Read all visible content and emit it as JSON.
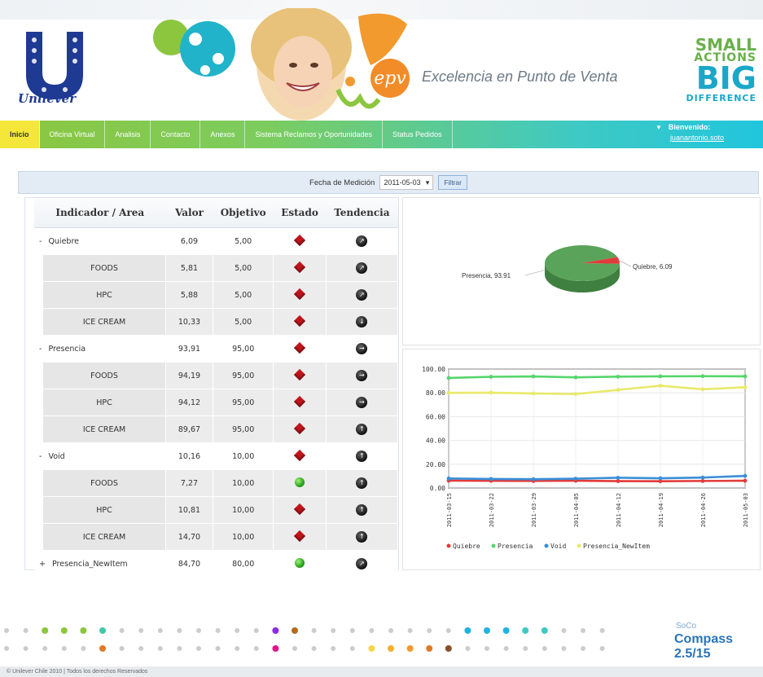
{
  "header": {
    "brand": "Unilever",
    "epv_logo": "epv",
    "tagline": "Excelencia en Punto de Venta",
    "slogan": {
      "line1": "SMALL",
      "line2": "ACTIONS",
      "line3": "BIG",
      "line4": "DIFFERENCE"
    }
  },
  "nav": {
    "items": [
      "Inicio",
      "Oficina Virtual",
      "Analisis",
      "Contacto",
      "Anexos",
      "Sistema Reclamos y Oportunidades",
      "Status Pedidos"
    ],
    "active": "Inicio",
    "welcome_label": "Bienvenido:",
    "username": "juanantonio.soto"
  },
  "filter": {
    "label": "Fecha de Medición",
    "date_value": "2011-05-03",
    "button_label": "Filtrar"
  },
  "table": {
    "headers": [
      "Indicador / Area",
      "Valor",
      "Objetivo",
      "Estado",
      "Tendencia"
    ],
    "rows": [
      {
        "kind": "group",
        "toggle": "-",
        "name": "Quiebre",
        "valor": "6,09",
        "objetivo": "5,00",
        "estado": "red-diamond",
        "tendencia": "arrow-up-right-icon"
      },
      {
        "kind": "sub",
        "name": "FOODS",
        "valor": "5,81",
        "objetivo": "5,00",
        "estado": "red-diamond",
        "tendencia": "arrow-up-right-icon"
      },
      {
        "kind": "sub",
        "name": "HPC",
        "valor": "5,88",
        "objetivo": "5,00",
        "estado": "red-diamond",
        "tendencia": "arrow-up-right-icon"
      },
      {
        "kind": "sub",
        "name": "ICE CREAM",
        "valor": "10,33",
        "objetivo": "5,00",
        "estado": "red-diamond",
        "tendencia": "arrow-down-icon"
      },
      {
        "kind": "group",
        "toggle": "-",
        "name": "Presencia",
        "valor": "93,91",
        "objetivo": "95,00",
        "estado": "red-diamond",
        "tendencia": "arrow-right-icon"
      },
      {
        "kind": "sub",
        "name": "FOODS",
        "valor": "94,19",
        "objetivo": "95,00",
        "estado": "red-diamond",
        "tendencia": "arrow-right-icon"
      },
      {
        "kind": "sub",
        "name": "HPC",
        "valor": "94,12",
        "objetivo": "95,00",
        "estado": "red-diamond",
        "tendencia": "arrow-right-icon"
      },
      {
        "kind": "sub",
        "name": "ICE CREAM",
        "valor": "89,67",
        "objetivo": "95,00",
        "estado": "red-diamond",
        "tendencia": "arrow-up-icon"
      },
      {
        "kind": "group",
        "toggle": "-",
        "name": "Void",
        "valor": "10,16",
        "objetivo": "10,00",
        "estado": "red-diamond",
        "tendencia": "arrow-up-icon"
      },
      {
        "kind": "sub",
        "name": "FOODS",
        "valor": "7,27",
        "objetivo": "10,00",
        "estado": "green-ball",
        "tendencia": "arrow-up-icon"
      },
      {
        "kind": "sub",
        "name": "HPC",
        "valor": "10,81",
        "objetivo": "10,00",
        "estado": "red-diamond",
        "tendencia": "arrow-up-icon"
      },
      {
        "kind": "sub",
        "name": "ICE CREAM",
        "valor": "14,70",
        "objetivo": "10,00",
        "estado": "red-diamond",
        "tendencia": "arrow-up-icon"
      },
      {
        "kind": "group",
        "toggle": "+",
        "name": "Presencia_NewItem",
        "valor": "84,70",
        "objetivo": "80,00",
        "estado": "green-ball",
        "tendencia": "arrow-up-right-icon"
      }
    ]
  },
  "pie": {
    "label_left": "Presencia, 93.91",
    "label_right": "Quiebre, 6.09",
    "colors": {
      "presencia": "#5aa35a",
      "quiebre": "#e23b3b"
    }
  },
  "chart_data": [
    {
      "type": "pie",
      "slices": [
        {
          "name": "Presencia",
          "value": 93.91
        },
        {
          "name": "Quiebre",
          "value": 6.09
        }
      ]
    },
    {
      "type": "line",
      "x": [
        "2011-03-15",
        "2011-03-22",
        "2011-03-29",
        "2011-04-05",
        "2011-04-12",
        "2011-04-19",
        "2011-04-26",
        "2011-05-03"
      ],
      "ylim": [
        0,
        100
      ],
      "yticks": [
        "0.00",
        "20.00",
        "40.00",
        "60.00",
        "80.00",
        "100.00"
      ],
      "grid": true,
      "legend_position": "bottom",
      "series": [
        {
          "name": "Quiebre",
          "color": "#e23b3b",
          "values": [
            6.2,
            6.0,
            5.9,
            6.1,
            5.8,
            5.7,
            5.9,
            6.09
          ]
        },
        {
          "name": "Presencia",
          "color": "#55d66b",
          "values": [
            92.5,
            93.5,
            93.8,
            93.0,
            93.6,
            93.9,
            94.0,
            93.91
          ]
        },
        {
          "name": "Void",
          "color": "#3a8fd8",
          "values": [
            8.0,
            7.6,
            7.4,
            7.8,
            8.6,
            8.2,
            8.8,
            10.16
          ]
        },
        {
          "name": "Presencia_NewItem",
          "color": "#e9e96a",
          "values": [
            80.0,
            80.2,
            79.5,
            79.0,
            82.5,
            86.0,
            83.0,
            84.7
          ]
        }
      ]
    }
  ],
  "footer": {
    "copyright": "© Unilever Chile 2010  |  Todos los derechos Reservados",
    "soco": "SoCo",
    "compass": "Compass 2.5/15"
  }
}
